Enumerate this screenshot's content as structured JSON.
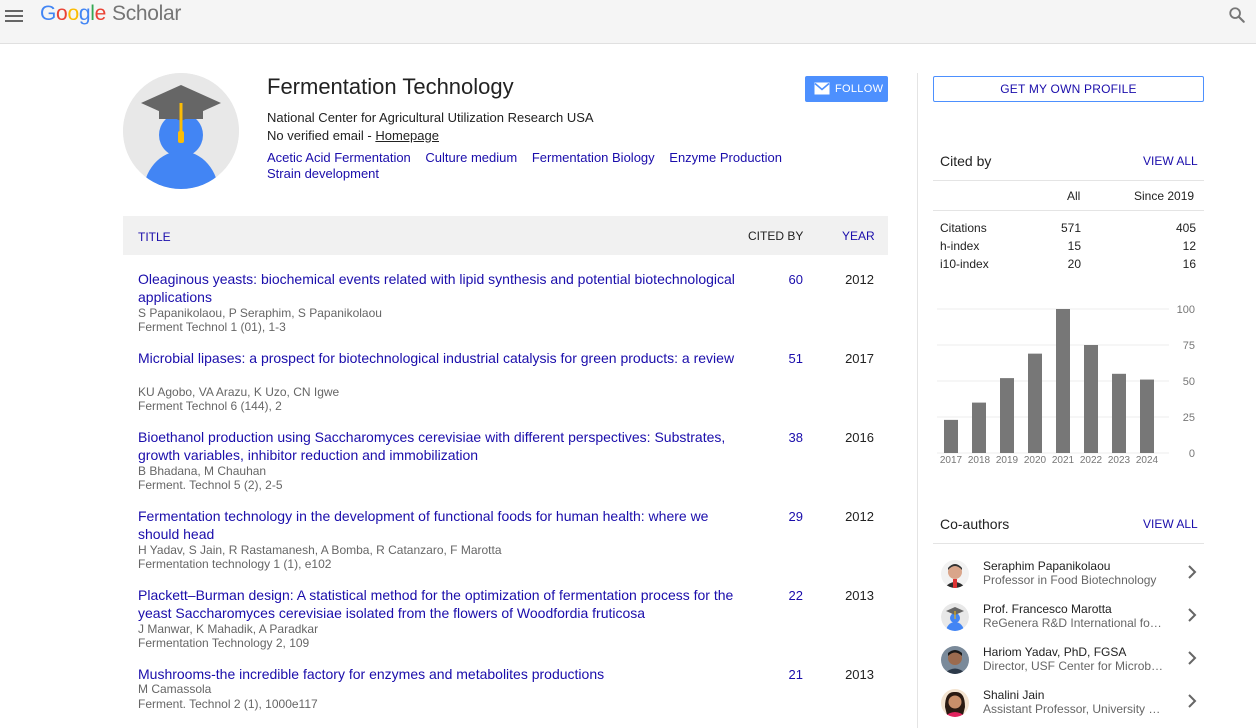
{
  "header": {
    "logo_letters": [
      "G",
      "o",
      "o",
      "g",
      "l",
      "e"
    ],
    "logo_product": "Scholar",
    "icons": {
      "menu": "menu-icon",
      "search": "search-icon"
    }
  },
  "profile": {
    "name": "Fermentation Technology",
    "affiliation": "National Center for Agricultural Utilization Research USA",
    "email_text": "No verified email - ",
    "homepage_label": "Homepage",
    "follow_label": "FOLLOW",
    "interests": [
      "Acetic Acid Fermentation",
      "Culture medium",
      "Fermentation Biology",
      "Enzyme Production",
      "Strain development"
    ]
  },
  "table": {
    "col_title": "TITLE",
    "col_cited": "CITED BY",
    "col_year": "YEAR",
    "rows": [
      {
        "title": "Oleaginous yeasts: biochemical events related with lipid synthesis and potential biotechnological applications",
        "authors": "S Papanikolaou, P Seraphim, S Papanikolaou",
        "venue": "Ferment Technol 1 (01), 1-3",
        "cited": "60",
        "year": "2012"
      },
      {
        "title": "Microbial lipases: a prospect for biotechnological industrial catalysis for green products: a review",
        "authors": "KU Agobo, VA Arazu, K Uzo, CN Igwe",
        "venue": "Ferment Technol 6 (144), 2",
        "cited": "51",
        "year": "2017"
      },
      {
        "title": "Bioethanol production using Saccharomyces cerevisiae with different perspectives: Substrates, growth variables, inhibitor reduction and immobilization",
        "authors": "B Bhadana, M Chauhan",
        "venue": "Ferment. Technol 5 (2), 2-5",
        "cited": "38",
        "year": "2016"
      },
      {
        "title": "Fermentation technology in the development of functional foods for human health: where we should head",
        "authors": "H Yadav, S Jain, R Rastamanesh, A Bomba, R Catanzaro, F Marotta",
        "venue": "Fermentation technology 1 (1), e102",
        "cited": "29",
        "year": "2012"
      },
      {
        "title": "Plackett–Burman design: A statistical method for the optimization of fermentation process for the yeast Saccharomyces cerevisiae isolated from the flowers of Woodfordia fruticosa",
        "authors": "J Manwar, K Mahadik, A Paradkar",
        "venue": "Fermentation Technology 2, 109",
        "cited": "22",
        "year": "2013"
      },
      {
        "title": "Mushrooms-the incredible factory for enzymes and metabolites productions",
        "authors": "M Camassola",
        "venue": "Ferment. Technol 2 (1), 1000e117",
        "cited": "21",
        "year": "2013"
      }
    ]
  },
  "sidebar": {
    "get_profile_label": "GET MY OWN PROFILE",
    "cited_by_title": "Cited by",
    "view_all": "VIEW ALL",
    "col_all": "All",
    "col_since": "Since 2019",
    "stats": [
      {
        "label": "Citations",
        "all": "571",
        "since": "405"
      },
      {
        "label": "h-index",
        "all": "15",
        "since": "12"
      },
      {
        "label": "i10-index",
        "all": "20",
        "since": "16"
      }
    ],
    "coauthors_title": "Co-authors",
    "coauthors": [
      {
        "name": "Seraphim Papanikolaou",
        "affiliation": "Professor in Food Biotechnology",
        "avatar": "photo"
      },
      {
        "name": "Prof. Francesco Marotta",
        "affiliation": "ReGenera R&D International for Aging Intervention",
        "avatar": "default"
      },
      {
        "name": "Hariom Yadav, PhD, FGSA",
        "affiliation": "Director, USF Center for Microbiome Research",
        "avatar": "photo"
      },
      {
        "name": "Shalini Jain",
        "affiliation": "Assistant Professor, University of South Florida",
        "avatar": "photo"
      }
    ]
  },
  "chart_data": {
    "type": "bar",
    "categories": [
      "2017",
      "2018",
      "2019",
      "2020",
      "2021",
      "2022",
      "2023",
      "2024"
    ],
    "values": [
      23,
      35,
      52,
      69,
      100,
      75,
      55,
      51
    ],
    "ylim": [
      0,
      100
    ],
    "yticks": [
      "0",
      "25",
      "50",
      "75",
      "100"
    ],
    "bar_color": "#777777",
    "grid": true
  }
}
